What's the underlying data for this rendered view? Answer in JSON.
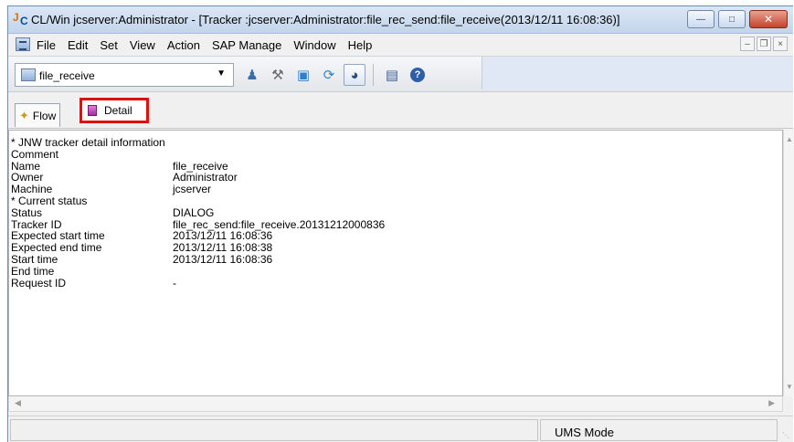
{
  "window": {
    "title": "CL/Win jcserver:Administrator - [Tracker :jcserver:Administrator:file_rec_send:file_receive(2013/12/11 16:08:36)]"
  },
  "menu": {
    "items": [
      "File",
      "Edit",
      "Set",
      "View",
      "Action",
      "SAP Manage",
      "Window",
      "Help"
    ]
  },
  "toolbar": {
    "combo_value": "file_receive"
  },
  "tabs": {
    "flow": "Flow",
    "detail": "Detail"
  },
  "detail": {
    "rows": [
      {
        "key": "* JNW tracker detail information",
        "value": ""
      },
      {
        "key": "Comment",
        "value": ""
      },
      {
        "key": "Name",
        "value": "file_receive"
      },
      {
        "key": "Owner",
        "value": "Administrator"
      },
      {
        "key": "Machine",
        "value": "jcserver"
      },
      {
        "key": "* Current status",
        "value": ""
      },
      {
        "key": "Status",
        "value": "DIALOG"
      },
      {
        "key": "Tracker ID",
        "value": "file_rec_send:file_receive.20131212000836"
      },
      {
        "key": "Expected start time",
        "value": "2013/12/11 16:08:36"
      },
      {
        "key": "Expected end time",
        "value": "2013/12/11 16:08:38"
      },
      {
        "key": "Start time",
        "value": "2013/12/11 16:08:36"
      },
      {
        "key": "End time",
        "value": ""
      },
      {
        "key": "Request ID",
        "value": "-"
      }
    ]
  },
  "status": {
    "mode": "UMS Mode"
  }
}
